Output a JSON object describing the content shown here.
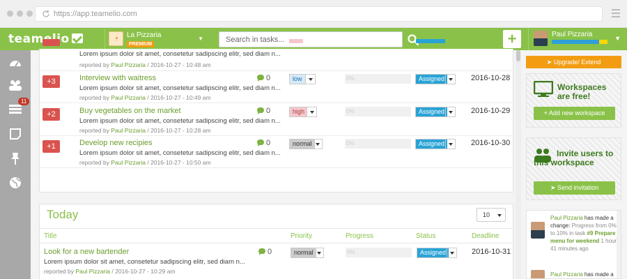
{
  "browser": {
    "url": "https://app.teamelio.com"
  },
  "topbar": {
    "logo": "teamelio",
    "workspace": {
      "name": "La Pizzaria",
      "badge": "PREMIUM"
    },
    "search_placeholder": "Search in tasks...",
    "user": {
      "name": "Paul Pizzaria",
      "progress_fraction": 0.85
    }
  },
  "sidebar": {
    "notifications_badge": "11"
  },
  "tasks": [
    {
      "priority": "",
      "title": "",
      "desc": "Lorem ipsum dolor sit amet, consetetur sadipscing elitr, sed diam n...",
      "reported_prefix": "reported by",
      "author": "Paul Pizzaria",
      "date": "/ 2016-10-27 - 10:48 am",
      "comments": "",
      "priority_level": "",
      "status": "",
      "deadline": ""
    },
    {
      "priority": "+3",
      "title": "Interview with waitress",
      "desc": "Lorem ipsum dolor sit amet, consetetur sadipscing elitr, sed diam n...",
      "reported_prefix": "reported by",
      "author": "Paul Pizzaria",
      "date": "/ 2016-10-27 - 10:49 am",
      "comments": "0",
      "priority_level": "low",
      "status": "Assigned",
      "deadline": "2016-10-28"
    },
    {
      "priority": "+2",
      "title": "Buy vegetables on the market",
      "desc": "Lorem ipsum dolor sit amet, consetetur sadipscing elitr, sed diam n...",
      "reported_prefix": "reported by",
      "author": "Paul Pizzaria",
      "date": "/ 2016-10-27 - 10:28 am",
      "comments": "0",
      "priority_level": "high",
      "status": "Assigned",
      "deadline": "2016-10-29"
    },
    {
      "priority": "+1",
      "title": "Develop new recipies",
      "desc": "Lorem ipsum dolor sit amet, consetetur sadipscing elitr, sed diam n...",
      "reported_prefix": "reported by",
      "author": "Paul Pizzaria",
      "date": "/ 2016-10-27 - 10:50 am",
      "comments": "0",
      "priority_level": "normal",
      "status": "Assigned",
      "deadline": "2016-10-30"
    }
  ],
  "today": {
    "title": "Today",
    "page_size": "10",
    "columns": {
      "title": "Title",
      "priority": "Priority",
      "progress": "Progress",
      "status": "Status",
      "deadline": "Deadline"
    },
    "task": {
      "title": "Look for a new bartender",
      "desc": "Lorem ipsum dolor sit amet, consetetur sadipscing elitr, sed diam n...",
      "reported_prefix": "reported by",
      "author": "Paul Pizzaria",
      "date": "/ 2016-10-27 - 10:29 am",
      "comments": "0",
      "priority_level": "normal",
      "status": "Assigned",
      "deadline": "2016-10-31"
    }
  },
  "right_panel": {
    "upgrade": "Upgrade/ Extend",
    "workspaces": {
      "title": "Workspaces are free!",
      "button": "+ Add new workspace"
    },
    "invite": {
      "title": "Invite users to this workspace",
      "button": "Send invitation"
    },
    "feed": [
      {
        "author": "Paul Pizzaria",
        "text1": "has made a change:",
        "text2": "Progress from 0% to 10% in task",
        "task": "#9 Prepare menu for weekend",
        "time": "1 hour, 41 minutes ago"
      },
      {
        "author": "Paul Pizzaria",
        "text1": "has made a",
        "text2": "",
        "task": "",
        "time": ""
      }
    ]
  },
  "colors": {
    "brand_green": "#8ac249",
    "priority_red": "#d9534f",
    "status_blue": "#29a3d6",
    "upgrade_orange": "#f39c12"
  }
}
